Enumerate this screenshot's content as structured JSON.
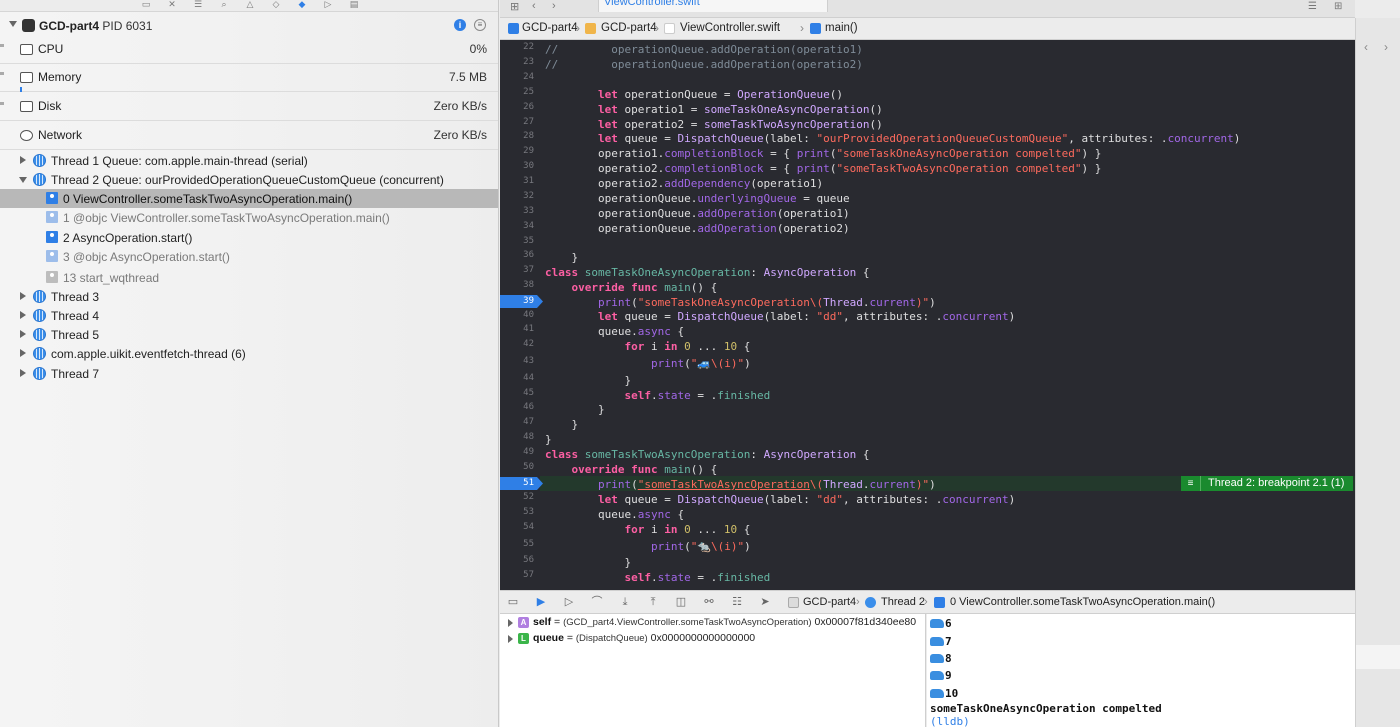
{
  "navigator": {
    "process_name": "GCD-part4",
    "process_pid": "PID 6031",
    "gauges": [
      {
        "label": "CPU",
        "value": "0%"
      },
      {
        "label": "Memory",
        "value": "7.5 MB"
      },
      {
        "label": "Disk",
        "value": "Zero KB/s"
      },
      {
        "label": "Network",
        "value": "Zero KB/s"
      }
    ],
    "threads": [
      {
        "label": "Thread 1 Queue: com.apple.main-thread (serial)"
      },
      {
        "label": "Thread 2 Queue: ourProvidedOperationQueueCustomQueue (concurrent)"
      },
      {
        "label": "Thread 3"
      },
      {
        "label": "Thread 4"
      },
      {
        "label": "Thread 5"
      },
      {
        "label": "com.apple.uikit.eventfetch-thread (6)"
      },
      {
        "label": "Thread 7"
      }
    ],
    "frames": [
      {
        "label": "0 ViewController.someTaskTwoAsyncOperation.main()"
      },
      {
        "label": "1 @objc ViewController.someTaskTwoAsyncOperation.main()"
      },
      {
        "label": "2 AsyncOperation.start()"
      },
      {
        "label": "3 @objc AsyncOperation.start()"
      },
      {
        "label": "13 start_wqthread"
      }
    ]
  },
  "editor": {
    "tab_title": "ViewController.swift",
    "jumpbar": [
      "GCD-part4",
      "GCD-part4",
      "ViewController.swift",
      "main()"
    ],
    "line_numbers": [
      "22",
      "23",
      "24",
      "25",
      "26",
      "27",
      "28",
      "29",
      "30",
      "31",
      "32",
      "33",
      "34",
      "35",
      "36",
      "37",
      "38",
      "39",
      "40",
      "41",
      "42",
      "43",
      "44",
      "45",
      "46",
      "47",
      "48",
      "49",
      "50",
      "51",
      "52",
      "53",
      "54",
      "55",
      "56",
      "57"
    ],
    "breakpoint_lines": [
      "39",
      "51"
    ],
    "breakpoint_badge": "Thread 2: breakpoint 2.1 (1)",
    "breakpoint_badge_icon": "stack-lines-icon"
  },
  "debug_bar": {
    "crumbs": [
      "GCD-part4",
      "Thread 2",
      "0 ViewController.someTaskTwoAsyncOperation.main()"
    ]
  },
  "variables": [
    {
      "badge": "A",
      "badge_color": "#b07fe0",
      "name": "self",
      "eq": " = ",
      "type": "(GCD_part4.ViewController.someTaskTwoAsyncOperation)",
      "value": " 0x00007f81d340ee80"
    },
    {
      "badge": "L",
      "badge_color": "#3bb54a",
      "name": "queue",
      "eq": " = ",
      "type": "(DispatchQueue)",
      "value": " 0x0000000000000000"
    }
  ],
  "console": {
    "car_lines": [
      "6",
      "7",
      "8",
      "9",
      "10"
    ],
    "completion_line": "someTaskOneAsyncOperation compelted",
    "prompt": "(lldb)"
  },
  "colors": {
    "accent": "#2f7fe6",
    "editor_bg": "#292a30",
    "breakpoint_green": "#1a8a2e"
  }
}
